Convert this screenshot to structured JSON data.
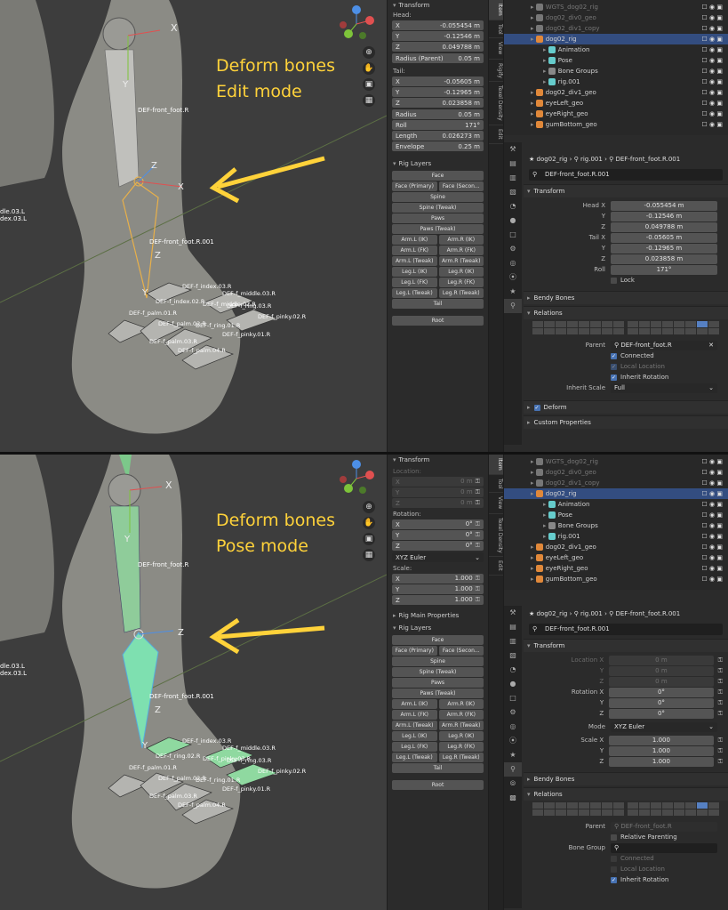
{
  "top": {
    "annotation": [
      "Deform bones",
      "Edit mode"
    ],
    "viewport_labels": {
      "bone_top": "DEF-front_foot.R",
      "bone_main": "DEF-front_foot.R.001",
      "left_cut_1": "dle.03.L",
      "left_cut_2": "dex.03.L",
      "toes": [
        "DEF-f_index.03.R",
        "DEF-f_middle.03.R",
        "DEF-f_ring.03.R",
        "DEF-f_pinky.02.R",
        "DEF-f_palm.01.R",
        "DEF-f_palm.02.R",
        "DEF-f_ring.01.R",
        "DEF-f_pinky.01.R",
        "DEF-f_palm.03.R",
        "DEF-f_palm.04.R",
        "DEF-f_index.02.R",
        "DEF-f_middle.02.R"
      ]
    },
    "npanel": {
      "transform_header": "Transform",
      "head_label": "Head:",
      "head": [
        {
          "label": "X",
          "value": "-0.055454 m"
        },
        {
          "label": "Y",
          "value": "-0.12546 m"
        },
        {
          "label": "Z",
          "value": "0.049788 m"
        }
      ],
      "radius_parent": {
        "label": "Radius (Parent)",
        "value": "0.05 m"
      },
      "tail_label": "Tail:",
      "tail": [
        {
          "label": "X",
          "value": "-0.05605 m"
        },
        {
          "label": "Y",
          "value": "-0.12965 m"
        },
        {
          "label": "Z",
          "value": "0.023858 m"
        }
      ],
      "extra": [
        {
          "label": "Radius",
          "value": "0.05 m"
        },
        {
          "label": "Roll",
          "value": "171°"
        },
        {
          "label": "Length",
          "value": "0.026273 m"
        },
        {
          "label": "Envelope",
          "value": "0.25 m"
        }
      ],
      "rig_layers_header": "Rig Layers",
      "rig_layers": [
        [
          "Face"
        ],
        [
          "Face (Primary)",
          "Face (Secon..."
        ],
        [
          "Spine"
        ],
        [
          "Spine (Tweak)"
        ],
        [
          "Paws"
        ],
        [
          "Paws (Tweak)"
        ],
        [
          "Arm.L (IK)",
          "Arm.R (IK)"
        ],
        [
          "Arm.L (FK)",
          "Arm.R (FK)"
        ],
        [
          "Arm.L (Tweak)",
          "Arm.R (Tweak)"
        ],
        [
          "Leg.L (IK)",
          "Leg.R (IK)"
        ],
        [
          "Leg.L (FK)",
          "Leg.R (FK)"
        ],
        [
          "Leg.L (Tweak)",
          "Leg.R (Tweak)"
        ],
        [
          "Tail"
        ]
      ],
      "root": "Root"
    },
    "vtabs": [
      "Item",
      "Tool",
      "View",
      "Rigify",
      "Texel Density",
      "Edit"
    ],
    "outliner": [
      {
        "label": "WGTS_dog02_rig",
        "dim": true
      },
      {
        "label": "dog02_div0_geo",
        "dim": true
      },
      {
        "label": "dog02_div1_copy",
        "dim": true
      },
      {
        "label": "dog02_rig",
        "sel": true
      },
      {
        "label": "Animation"
      },
      {
        "label": "Pose"
      },
      {
        "label": "Bone Groups"
      },
      {
        "label": "rig.001"
      },
      {
        "label": "dog02_div1_geo"
      },
      {
        "label": "eyeLeft_geo"
      },
      {
        "label": "eyeRight_geo"
      },
      {
        "label": "gumBottom_geo"
      }
    ],
    "breadcrumb": [
      "dog02_rig",
      "rig.001",
      "DEF-front_foot.R.001"
    ],
    "bone_name": "DEF-front_foot.R.001",
    "transform_header": "Transform",
    "props": [
      {
        "label": "Head X",
        "value": "-0.055454 m"
      },
      {
        "label": "Y",
        "value": "-0.12546 m"
      },
      {
        "label": "Z",
        "value": "0.049788 m"
      },
      {
        "label": "Tail X",
        "value": "-0.05605 m"
      },
      {
        "label": "Y",
        "value": "-0.12965 m"
      },
      {
        "label": "Z",
        "value": "0.023858 m"
      },
      {
        "label": "Roll",
        "value": "171°"
      }
    ],
    "lock": "Lock",
    "bendy": "Bendy Bones",
    "relations": "Relations",
    "parent_label": "Parent",
    "parent_value": "DEF-front_foot.R",
    "connected": "Connected",
    "local_location": "Local Location",
    "inherit_rotation": "Inherit Rotation",
    "inherit_scale_label": "Inherit Scale",
    "inherit_scale_value": "Full",
    "deform": "Deform",
    "custom_props": "Custom Properties"
  },
  "bottom": {
    "annotation": [
      "Deform bones",
      "Pose mode"
    ],
    "viewport_labels": {
      "bone_top": "DEF-front_foot.R",
      "bone_main": "DEF-front_foot.R.001",
      "left_cut_1": "dle.03.L",
      "left_cut_2": "dex.03.L",
      "toes": [
        "DEF-f_index.03.R",
        "DEF-f_middle.03.R",
        "DEF-f_ring.03.R",
        "DEF-f_pinky.02.R",
        "DEF-f_palm.01.R",
        "DEF-f_palm.02.R",
        "DEF-f_ring.01.R",
        "DEF-f_pinky.01.R",
        "DEF-f_palm.03.R",
        "DEF-f_palm.04.R",
        "DEF-f_ring.02.R",
        "DEF-f_pinky.03.R"
      ]
    },
    "npanel": {
      "transform_header": "Transform",
      "location_label": "Location:",
      "location": [
        {
          "label": "X",
          "value": "0 m"
        },
        {
          "label": "Y",
          "value": "0 m"
        },
        {
          "label": "Z",
          "value": "0 m"
        }
      ],
      "rotation_label": "Rotation:",
      "rotation": [
        {
          "label": "X",
          "value": "0°"
        },
        {
          "label": "Y",
          "value": "0°"
        },
        {
          "label": "Z",
          "value": "0°"
        }
      ],
      "rotation_mode": "XYZ Euler",
      "scale_label": "Scale:",
      "scale": [
        {
          "label": "X",
          "value": "1.000"
        },
        {
          "label": "Y",
          "value": "1.000"
        },
        {
          "label": "Z",
          "value": "1.000"
        }
      ],
      "rig_main_header": "Rig Main Properties",
      "rig_layers_header": "Rig Layers",
      "rig_layers": [
        [
          "Face"
        ],
        [
          "Face (Primary)",
          "Face (Secon..."
        ],
        [
          "Spine"
        ],
        [
          "Spine (Tweak)"
        ],
        [
          "Paws"
        ],
        [
          "Paws (Tweak)"
        ],
        [
          "Arm.L (IK)",
          "Arm.R (IK)"
        ],
        [
          "Arm.L (FK)",
          "Arm.R (FK)"
        ],
        [
          "Arm.L (Tweak)",
          "Arm.R (Tweak)"
        ],
        [
          "Leg.L (IK)",
          "Leg.R (IK)"
        ],
        [
          "Leg.L (FK)",
          "Leg.R (FK)"
        ],
        [
          "Leg.L (Tweak)",
          "Leg.R (Tweak)"
        ],
        [
          "Tail"
        ]
      ],
      "root": "Root"
    },
    "vtabs": [
      "Item",
      "Tool",
      "View",
      "Texel Density",
      "Edit"
    ],
    "outliner": [
      {
        "label": "WGTS_dog02_rig",
        "dim": true
      },
      {
        "label": "dog02_div0_geo",
        "dim": true
      },
      {
        "label": "dog02_div1_copy",
        "dim": true
      },
      {
        "label": "dog02_rig",
        "sel": true
      },
      {
        "label": "Animation"
      },
      {
        "label": "Pose"
      },
      {
        "label": "Bone Groups"
      },
      {
        "label": "rig.001"
      },
      {
        "label": "dog02_div1_geo"
      },
      {
        "label": "eyeLeft_geo"
      },
      {
        "label": "eyeRight_geo"
      },
      {
        "label": "gumBottom_geo"
      }
    ],
    "breadcrumb": [
      "dog02_rig",
      "rig.001",
      "DEF-front_foot.R.001"
    ],
    "bone_name": "DEF-front_foot.R.001",
    "transform_header": "Transform",
    "props": [
      {
        "label": "Location X",
        "value": "0 m",
        "dim": true
      },
      {
        "label": "Y",
        "value": "0 m",
        "dim": true
      },
      {
        "label": "Z",
        "value": "0 m",
        "dim": true
      },
      {
        "label": "Rotation X",
        "value": "0°"
      },
      {
        "label": "Y",
        "value": "0°"
      },
      {
        "label": "Z",
        "value": "0°"
      }
    ],
    "mode_label": "Mode",
    "mode_value": "XYZ Euler",
    "scale_props": [
      {
        "label": "Scale X",
        "value": "1.000"
      },
      {
        "label": "Y",
        "value": "1.000"
      },
      {
        "label": "Z",
        "value": "1.000"
      }
    ],
    "bendy": "Bendy Bones",
    "relations": "Relations",
    "parent_label": "Parent",
    "parent_value": "DEF-front_foot.R",
    "relative_parenting": "Relative Parenting",
    "bone_group_label": "Bone Group",
    "connected": "Connected",
    "local_location": "Local Location",
    "inherit_rotation": "Inherit Rotation"
  },
  "colors": {
    "annotation": "#ffd23a",
    "selected_row": "#334d80",
    "edit_bone": "#e8b04a",
    "pose_bone": "#6fdcaa",
    "axis_x": "#e05050",
    "axis_y": "#7ec43a",
    "axis_z": "#4d8fe6"
  }
}
